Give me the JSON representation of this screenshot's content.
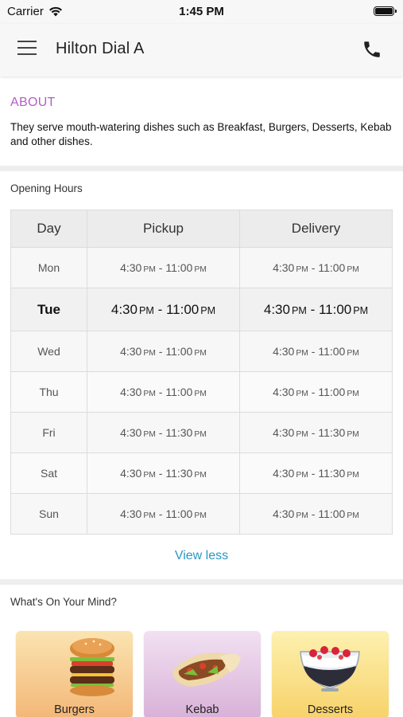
{
  "status_bar": {
    "carrier": "Carrier",
    "time": "1:45 PM"
  },
  "header": {
    "title": "Hilton Dial A",
    "menu_icon": "hamburger-icon",
    "call_icon": "phone-icon"
  },
  "about": {
    "title": "ABOUT",
    "text": "They serve mouth-watering dishes such as Breakfast, Burgers, Desserts, Kebab and other dishes.",
    "title_color": "#b45dc6"
  },
  "opening_hours": {
    "label": "Opening Hours",
    "columns": [
      "Day",
      "Pickup",
      "Delivery"
    ],
    "rows": [
      {
        "day": "Mon",
        "pickup": {
          "start": "4:30",
          "start_ampm": "PM",
          "end": "11:00",
          "end_ampm": "PM"
        },
        "delivery": {
          "start": "4:30",
          "start_ampm": "PM",
          "end": "11:00",
          "end_ampm": "PM"
        }
      },
      {
        "day": "Tue",
        "pickup": {
          "start": "4:30",
          "start_ampm": "PM",
          "end": "11:00",
          "end_ampm": "PM"
        },
        "delivery": {
          "start": "4:30",
          "start_ampm": "PM",
          "end": "11:00",
          "end_ampm": "PM"
        }
      },
      {
        "day": "Wed",
        "pickup": {
          "start": "4:30",
          "start_ampm": "PM",
          "end": "11:00",
          "end_ampm": "PM"
        },
        "delivery": {
          "start": "4:30",
          "start_ampm": "PM",
          "end": "11:00",
          "end_ampm": "PM"
        }
      },
      {
        "day": "Thu",
        "pickup": {
          "start": "4:30",
          "start_ampm": "PM",
          "end": "11:00",
          "end_ampm": "PM"
        },
        "delivery": {
          "start": "4:30",
          "start_ampm": "PM",
          "end": "11:00",
          "end_ampm": "PM"
        }
      },
      {
        "day": "Fri",
        "pickup": {
          "start": "4:30",
          "start_ampm": "PM",
          "end": "11:30",
          "end_ampm": "PM"
        },
        "delivery": {
          "start": "4:30",
          "start_ampm": "PM",
          "end": "11:30",
          "end_ampm": "PM"
        }
      },
      {
        "day": "Sat",
        "pickup": {
          "start": "4:30",
          "start_ampm": "PM",
          "end": "11:30",
          "end_ampm": "PM"
        },
        "delivery": {
          "start": "4:30",
          "start_ampm": "PM",
          "end": "11:30",
          "end_ampm": "PM"
        }
      },
      {
        "day": "Sun",
        "pickup": {
          "start": "4:30",
          "start_ampm": "PM",
          "end": "11:00",
          "end_ampm": "PM"
        },
        "delivery": {
          "start": "4:30",
          "start_ampm": "PM",
          "end": "11:00",
          "end_ampm": "PM"
        }
      }
    ],
    "today": "Tue",
    "view_less": "View less",
    "link_color": "#2a97c4"
  },
  "mind": {
    "label": "What's On Your Mind?",
    "categories": [
      {
        "label": "Burgers",
        "icon": "burger-image"
      },
      {
        "label": "Kebab",
        "icon": "kebab-image"
      },
      {
        "label": "Desserts",
        "icon": "dessert-image"
      }
    ]
  }
}
